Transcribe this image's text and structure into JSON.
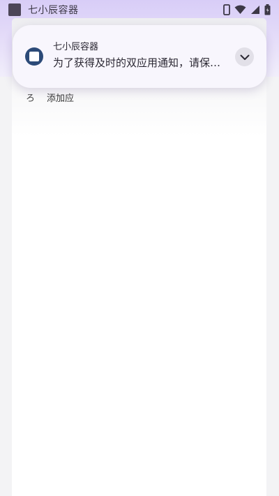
{
  "status_bar": {
    "app_title": "七小辰容器",
    "icons": [
      "app-square-icon",
      "phone-icon",
      "wifi-icon",
      "signal-icon",
      "battery-icon"
    ]
  },
  "notification": {
    "app_name": "七小辰容器",
    "message": "为了获得及时的双应用通知，请保持…",
    "icon": "app-logo-icon",
    "expand_icon": "chevron-down-icon"
  },
  "content": {
    "add_row_glyph": "ろ",
    "add_row_label": "添加应"
  },
  "colors": {
    "tint": "#d8cdf7",
    "notification_bg": "#f8f6fd",
    "app_icon": "#2c4a78"
  }
}
